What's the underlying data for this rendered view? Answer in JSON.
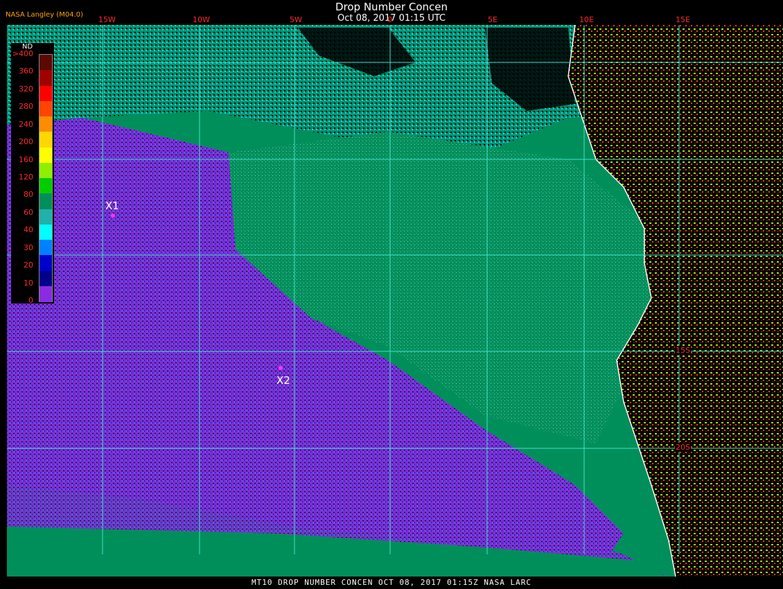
{
  "header": {
    "credit": "NASA Langley (M04.0)",
    "title": "Drop Number Concen",
    "subtitle": "Oct 08, 2017 01:15 UTC"
  },
  "footer": {
    "text": "MT10  DROP NUMBER CONCEN   OCT 08, 2017 01:15Z   NASA LARC"
  },
  "lon_labels": [
    "15W",
    "10W",
    "5W",
    "0",
    "5E",
    "10E",
    "15E"
  ],
  "lat_labels": [
    "15S",
    "20S"
  ],
  "legend": {
    "title": "ND",
    "labels": [
      ">400",
      "360",
      "320",
      "280",
      "240",
      "200",
      "160",
      "120",
      "80",
      "60",
      "40",
      "30",
      "20",
      "10",
      "0"
    ],
    "colors": [
      "#5a0a00",
      "#a00000",
      "#ff0000",
      "#ff4500",
      "#ff8c00",
      "#ffd700",
      "#ffff00",
      "#90ee00",
      "#00cc00",
      "#008f5a",
      "#20b2aa",
      "#00ffff",
      "#0080ff",
      "#0000cd",
      "#00008b",
      "#8a2be2"
    ]
  },
  "markers": [
    {
      "label": "X1"
    },
    {
      "label": "X2"
    }
  ],
  "colors": {
    "grid": "#40e0d0",
    "coast": "#ffffff",
    "ocean_base": "#008f5a",
    "low": "#7b2fd6",
    "teal": "#3fae9a",
    "land": "#000000"
  }
}
